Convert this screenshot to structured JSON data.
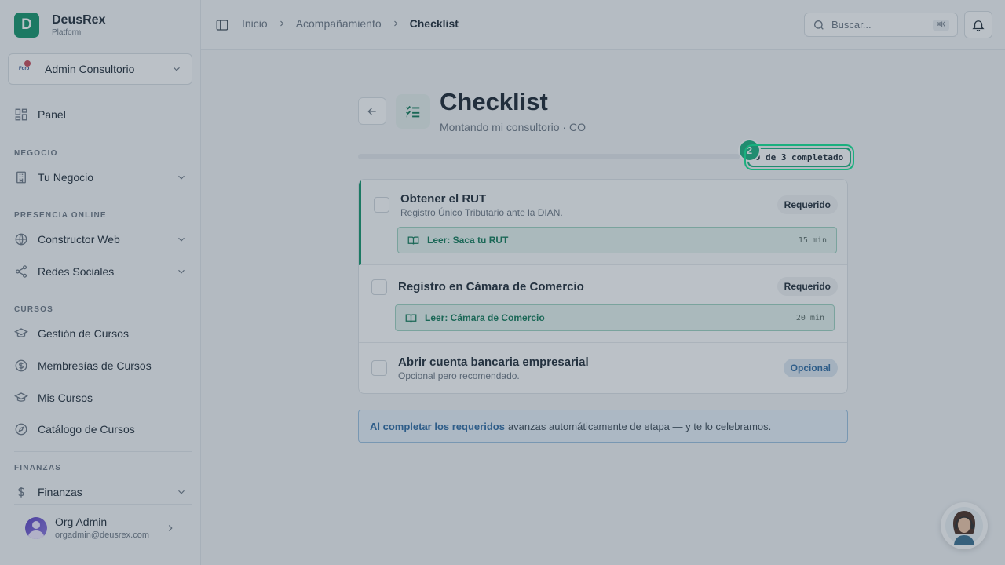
{
  "brand": {
    "initial": "D",
    "name": "DeusRex",
    "subtitle": "Platform"
  },
  "org": {
    "name": "Admin Consultorio",
    "logo_text": "Foro"
  },
  "sidebar": {
    "panel": "Panel",
    "sections": {
      "negocio": "NEGOCIO",
      "presencia": "PRESENCIA ONLINE",
      "cursos": "CURSOS",
      "finanzas": "FINANZAS"
    },
    "items": {
      "tu_negocio": "Tu Negocio",
      "constructor_web": "Constructor Web",
      "redes_sociales": "Redes Sociales",
      "gestion_cursos": "Gestión de Cursos",
      "membresias": "Membresías de Cursos",
      "mis_cursos": "Mis Cursos",
      "catalogo": "Catálogo de Cursos",
      "finanzas": "Finanzas"
    }
  },
  "user": {
    "name": "Org Admin",
    "email": "orgadmin@deusrex.com"
  },
  "breadcrumb": {
    "home": "Inicio",
    "parent": "Acompañamiento",
    "current": "Checklist"
  },
  "search": {
    "placeholder": "Buscar...",
    "shortcut": "⌘K"
  },
  "page": {
    "title": "Checklist",
    "subtitle": "Montando mi consultorio · CO",
    "progress": {
      "completed": 0,
      "total": 3,
      "label": "0 de 3 completado"
    },
    "step_badge": "2"
  },
  "tasks": [
    {
      "title": "Obtener el RUT",
      "description": "Registro Único Tributario ante la DIAN.",
      "tag": "Requerido",
      "resource": {
        "title": "Leer: Saca tu RUT",
        "time": "15 min"
      }
    },
    {
      "title": "Registro en Cámara de Comercio",
      "tag": "Requerido",
      "resource": {
        "title": "Leer: Cámara de Comercio",
        "time": "20 min"
      }
    },
    {
      "title": "Abrir cuenta bancaria empresarial",
      "description": "Opcional pero recomendado.",
      "tag": "Opcional"
    }
  ],
  "notice": {
    "strong": "Al completar los requeridos",
    "rest": "avanzas automáticamente de etapa — y te lo celebramos."
  },
  "colors": {
    "accent": "#12946b",
    "accent_light": "#1ab07e",
    "info": "#2e6aa3"
  }
}
